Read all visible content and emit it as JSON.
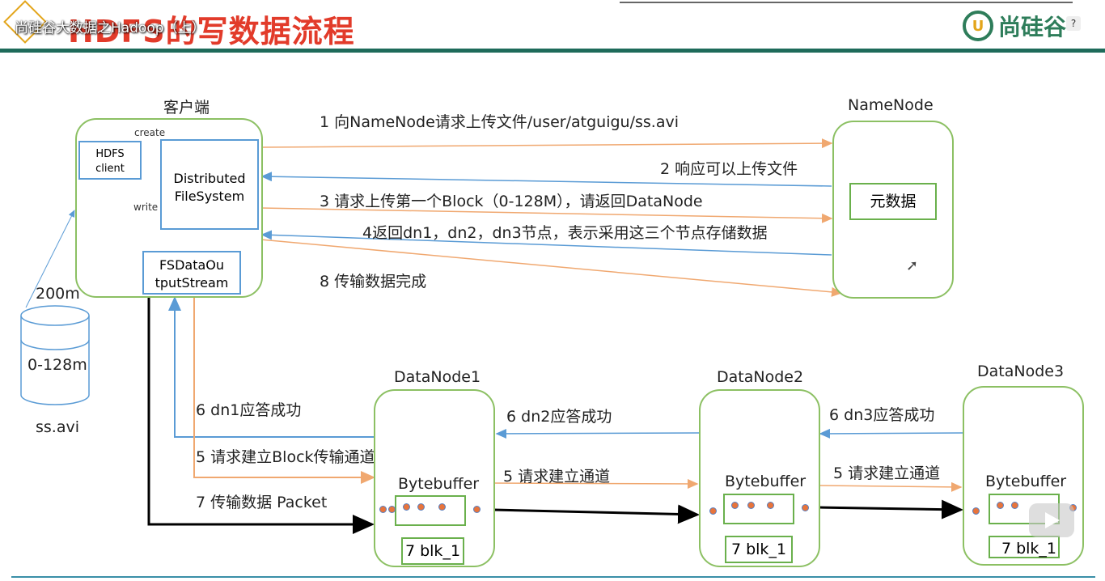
{
  "header": {
    "slide_title": "HDFS的写数据流程",
    "video_title": "尚硅谷大数据之Hadoop（上）",
    "brand": "尚硅谷",
    "brand_mark": "U",
    "help": "?"
  },
  "client": {
    "title": "客户端",
    "hdfs_client": [
      "HDFS",
      "client"
    ],
    "dfs": [
      "Distributed",
      "FileSystem"
    ],
    "fsdos": [
      "FSDataOu",
      "tputStream"
    ],
    "create": "create",
    "write": "write"
  },
  "file": {
    "size": "200m",
    "block": "0-128m",
    "name": "ss.avi"
  },
  "namenode": {
    "title": "NameNode",
    "meta": "元数据"
  },
  "steps": {
    "s1": "1 向NameNode请求上传文件/user/atguigu/ss.avi",
    "s2": "2 响应可以上传文件",
    "s3": "3 请求上传第一个Block（0-128M），请返回DataNode",
    "s4": "4返回dn1，dn2，dn3节点，表示采用这三个节点存储数据",
    "s8": "8 传输数据完成",
    "s6a": "6 dn1应答成功",
    "s5a": "5 请求建立Block传输通道",
    "s7": "7 传输数据  Packet",
    "s6b": "6 dn2应答成功",
    "s5b": "5 请求建立通道",
    "s6c": "6 dn3应答成功",
    "s5c": "5 请求建立通道"
  },
  "datanodes": [
    {
      "title": "DataNode1",
      "buffer": "Bytebuffer",
      "blk": "7 blk_1"
    },
    {
      "title": "DataNode2",
      "buffer": "Bytebuffer",
      "blk": "7 blk_1"
    },
    {
      "title": "DataNode3",
      "buffer": "Bytebuffer",
      "blk": "7 blk_1"
    }
  ],
  "colors": {
    "request_arrow": "#f0a870",
    "response_arrow": "#5a9bd5",
    "data_arrow": "#000000",
    "node_border": "#8cc063",
    "title_red": "#e23b2a"
  }
}
